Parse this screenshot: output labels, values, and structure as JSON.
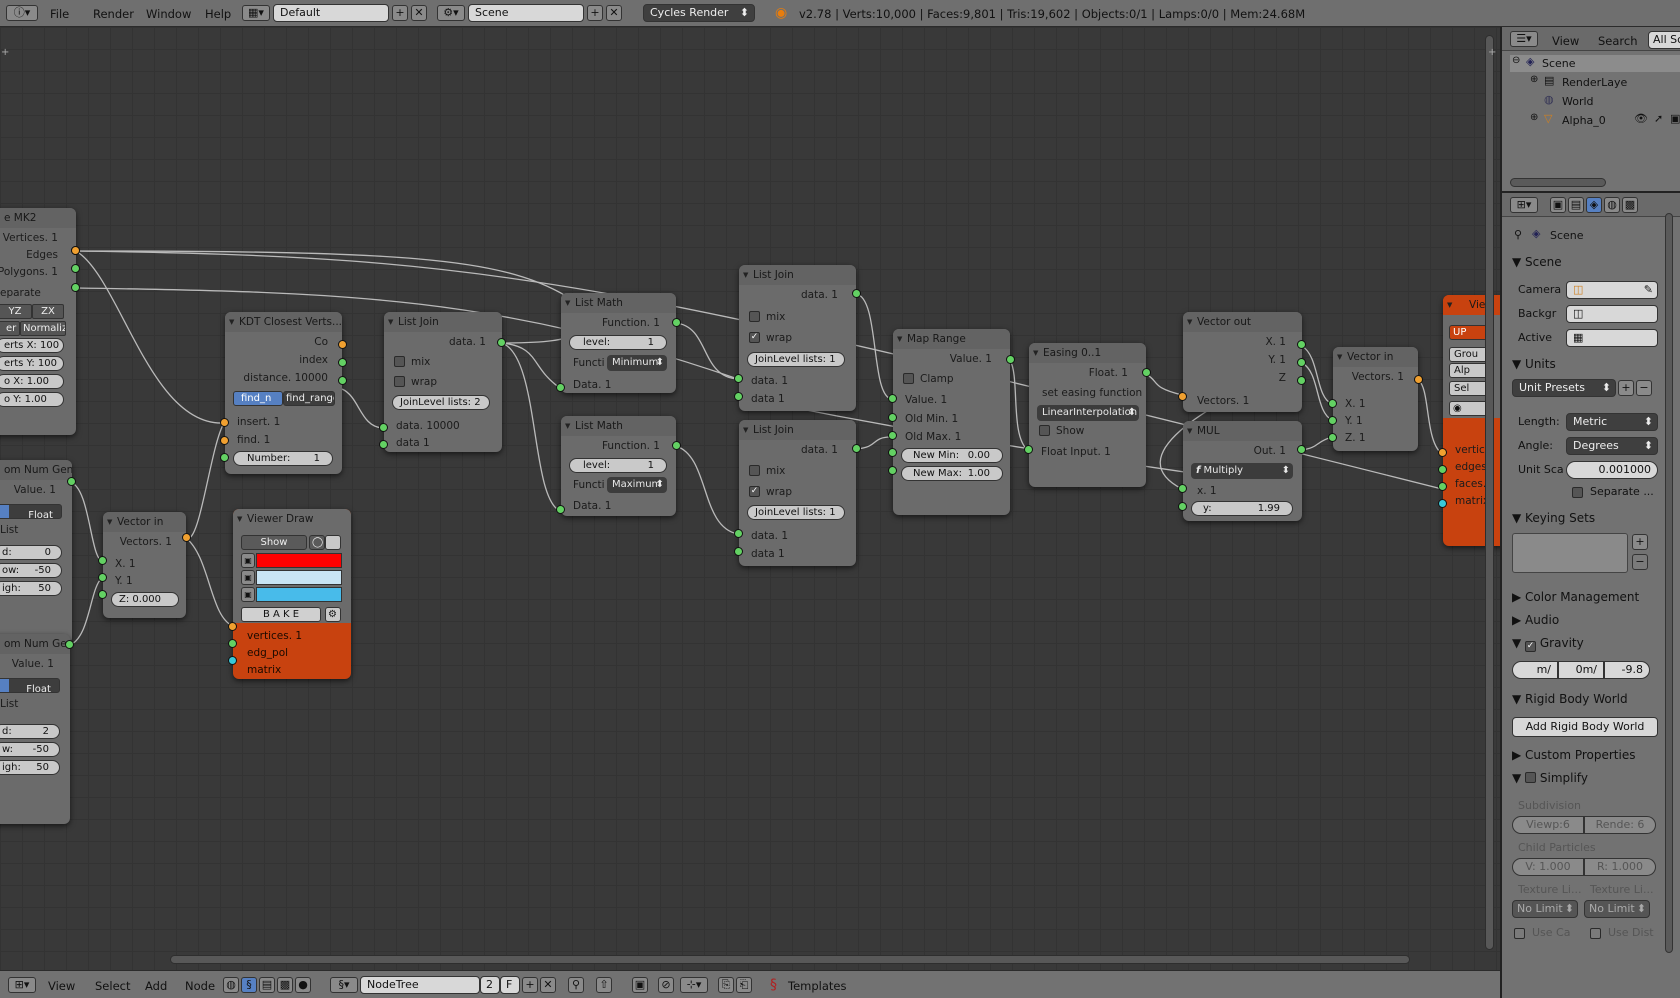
{
  "topbar": {
    "menus": [
      "File",
      "Render",
      "Window",
      "Help"
    ],
    "layout": "Default",
    "scene": "Scene",
    "engine": "Cycles Render",
    "stats": "v2.78 | Verts:10,000 | Faces:9,801 | Tris:19,602 | Objects:0/1 | Lamps:0/0 | Mem:24.68M"
  },
  "bottombar": {
    "menus": [
      "View",
      "Select",
      "Add",
      "Node"
    ],
    "tree_name": "NodeTree",
    "users": "2",
    "fake": "F",
    "templates": "Templates"
  },
  "outliner": {
    "menus": [
      "View",
      "Search",
      "All Sc"
    ],
    "items": [
      "Scene",
      "RenderLaye",
      "World",
      "Alpha_0"
    ]
  },
  "props": {
    "context": "Scene",
    "scene_panel": {
      "title": "Scene",
      "camera_label": "Camera",
      "background_label": "Backgr",
      "active_label": "Active"
    },
    "units": {
      "title": "Units",
      "presets": "Unit Presets",
      "length_label": "Length:",
      "length": "Metric",
      "angle_label": "Angle:",
      "angle": "Degrees",
      "scale_label": "Unit Sca",
      "scale": "0.001000",
      "separate": "Separate ..."
    },
    "keying": {
      "title": "Keying Sets"
    },
    "color_mgmt": "Color Management",
    "audio": "Audio",
    "gravity": {
      "title": "Gravity",
      "x": "m/",
      "y": "0m/",
      "z": "-9.8"
    },
    "rigid": {
      "title": "Rigid Body World",
      "button": "Add Rigid Body World"
    },
    "custom": "Custom Properties",
    "simplify": {
      "title": "Simplify",
      "subdivision": "Subdivision",
      "viewport": "Viewp:6",
      "render": "Rende: 6",
      "child_particles": "Child Particles",
      "v": "V: 1.000",
      "r": "R: 1.000",
      "tex1": "Texture Li...",
      "tex2": "Texture Li...",
      "nolimit1": "No Limit",
      "nolimit2": "No Limit",
      "useca": "Use Ca",
      "usedist": "Use Dist"
    }
  },
  "nodes": {
    "mk2": {
      "title": "e MK2",
      "vertices": "Vertices. 1",
      "edges": "Edges",
      "polygons": "Polygons. 1",
      "separate": "eparate",
      "yz": "YZ",
      "zx": "ZX",
      "er": "er",
      "normalize": "Normalize",
      "vx": "erts X: 100",
      "vy": "erts Y: 100",
      "sx": "o X:  1.00",
      "sy": "o Y:  1.00"
    },
    "rng1": {
      "title": "om Num Gen",
      "value": "Value. 1",
      "float": "Float",
      "list": "List",
      "f1": "d:",
      "f1v": "0",
      "f2": "ow:",
      "f2v": "-50",
      "f3": "igh:",
      "f3v": "50"
    },
    "rng2": {
      "title": "om Num Gen",
      "value": "Value. 1",
      "float": "Float",
      "list": "List",
      "f1": "d:",
      "f1v": "2",
      "f2": "w:",
      "f2v": "-50",
      "f3": "igh:",
      "f3v": "50"
    },
    "kdt": {
      "title": "KDT Closest Verts...",
      "co": "Co",
      "index": "index",
      "distance": "distance. 10000",
      "find_n": "find_n",
      "find_range": "find_range",
      "insert": "insert. 1",
      "find": "find. 1",
      "number": "Number:",
      "number_v": "1"
    },
    "vecin1": {
      "title": "Vector in",
      "vectors": "Vectors. 1",
      "x": "X. 1",
      "y": "Y. 1",
      "z": "Z: 0.000"
    },
    "viewer_draw": {
      "title": "Viewer Draw",
      "show": "Show",
      "bake": "B A K E",
      "vertices": "vertices. 1",
      "edg_pol": "edg_pol",
      "matrix": "matrix"
    },
    "listjoin1": {
      "title": "List Join",
      "data_out": "data. 1",
      "mix": "mix",
      "wrap": "wrap",
      "join": "JoinLevel lists: 2",
      "data_in": "data. 10000",
      "data_in2": "data 1"
    },
    "listmath1": {
      "title": "List Math",
      "function": "Function. 1",
      "level": "level:",
      "level_v": "1",
      "functi": "Functi",
      "mode": "Minimum",
      "data": "Data. 1"
    },
    "listmath2": {
      "title": "List Math",
      "function": "Function. 1",
      "level": "level:",
      "level_v": "1",
      "functi": "Functi",
      "mode": "Maximum",
      "data": "Data. 1"
    },
    "listjoin2": {
      "title": "List Join",
      "data_out": "data. 1",
      "mix": "mix",
      "wrap": "wrap",
      "join": "JoinLevel lists: 1",
      "data_in": "data. 1",
      "data_in2": "data 1"
    },
    "listjoin3": {
      "title": "List Join",
      "data_out": "data. 1",
      "mix": "mix",
      "wrap": "wrap",
      "join": "JoinLevel lists: 1",
      "data_in": "data. 1",
      "data_in2": "data 1"
    },
    "maprange": {
      "title": "Map Range",
      "value_out": "Value. 1",
      "clamp": "Clamp",
      "value_in": "Value. 1",
      "oldmin": "Old Min. 1",
      "oldmax": "Old Max. 1",
      "newmin": "New Min:",
      "newmin_v": "0.00",
      "newmax": "New Max:",
      "newmax_v": "1.00"
    },
    "easing": {
      "title": "Easing 0..1",
      "float": "Float. 1",
      "set": "set easing function",
      "func": "LinearInterpolation",
      "show": "Show",
      "input": "Float Input. 1"
    },
    "vecout": {
      "title": "Vector out",
      "x": "X. 1",
      "y": "Y. 1",
      "z": "Z",
      "vectors": "Vectors. 1"
    },
    "mul": {
      "title": "MUL",
      "out": "Out. 1",
      "op": "Multiply",
      "x": "x. 1",
      "y": "y:",
      "y_v": "1.99"
    },
    "vecin2": {
      "title": "Vector in",
      "vectors": "Vectors. 1",
      "x": "X. 1",
      "y": "Y. 1",
      "z": "Z. 1"
    },
    "viewer": {
      "title": "View",
      "up": "UP",
      "grou": "Grou",
      "alp": "Alp",
      "sel": "Sel",
      "vertic": "vertic",
      "edges": "edges",
      "faces": "faces.",
      "matrix": "matrix"
    }
  },
  "colors": {
    "accent_blue": "#5680c2",
    "viewer_orange": "#c8420f",
    "socket_green": "#63d163",
    "socket_orange": "#f0a030",
    "socket_cyan": "#3ac8d8",
    "draw_red": "#ff0000",
    "draw_lightblue": "#c8e4f4",
    "draw_skyblue": "#48bbea"
  }
}
